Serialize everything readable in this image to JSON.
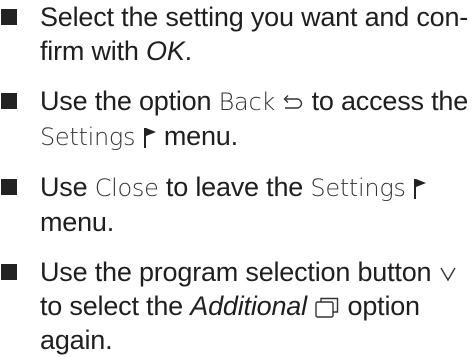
{
  "steps": [
    {
      "t1": "Select the setting you want and con-",
      "t2": "firm with ",
      "ok": "OK",
      "t3": "."
    },
    {
      "t1": "Use the option ",
      "back": "Back",
      "t2": " to access the",
      "settings": "Settings",
      "t3": " menu."
    },
    {
      "t1": "Use ",
      "close": "Close",
      "t2": " to leave the ",
      "settings": "Settings",
      "t3": "menu."
    },
    {
      "t1": "Use the program selection button",
      "t2": "to select the ",
      "additional": "Additional",
      "t3": " option",
      "t4": "again."
    }
  ],
  "icons": {
    "back": "back-arrow-icon",
    "settings": "flag-icon",
    "selection": "chevron-down-icon",
    "additional": "additional-window-icon"
  }
}
